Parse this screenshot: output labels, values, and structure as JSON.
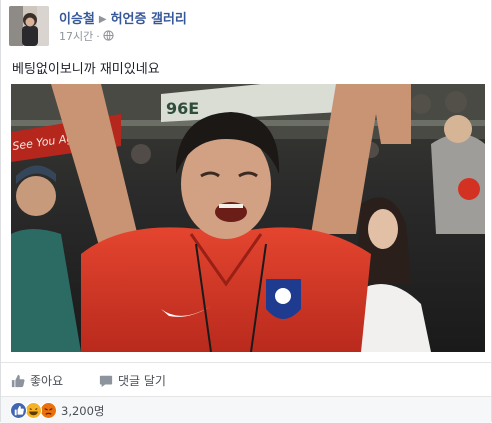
{
  "post": {
    "author": "이승철",
    "group": "허언증 갤러리",
    "time": "17시간",
    "separator": "·",
    "text": "베팅없이보니까 재미있네요"
  },
  "photo_overlay": {
    "stand_sign": "96E",
    "banner_text": "See You Aga"
  },
  "actions": {
    "like_label": "좋아요",
    "comment_label": "댓글 달기"
  },
  "reactions": {
    "count_label": "3,200명",
    "icons": [
      "like-icon",
      "haha-icon",
      "angry-icon"
    ],
    "colors": {
      "like": "#4267b2",
      "haha": "#f7b125",
      "angry": "#e9710f"
    }
  }
}
